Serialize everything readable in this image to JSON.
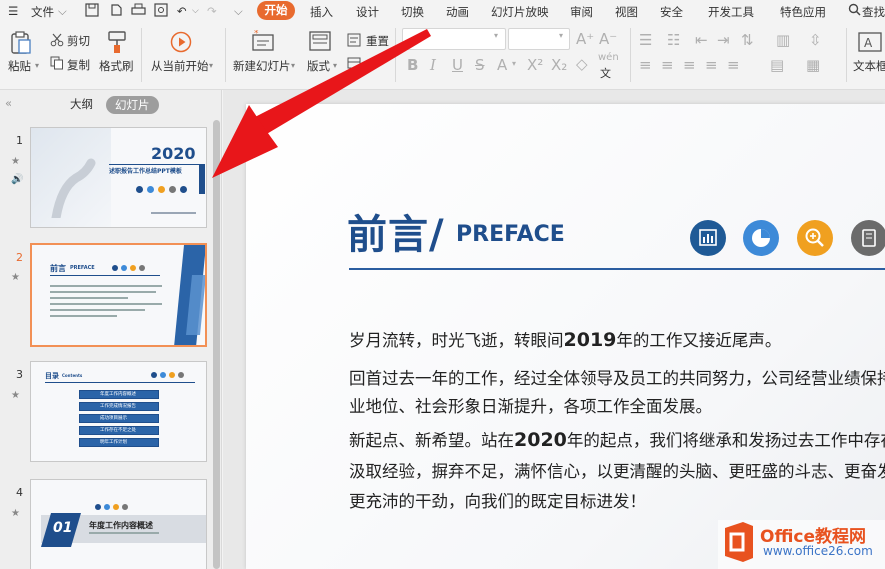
{
  "menubar": {
    "file": "文件",
    "tabs": [
      "开始",
      "插入",
      "设计",
      "切换",
      "动画",
      "幻灯片放映",
      "审阅",
      "视图",
      "安全",
      "开发工具",
      "特色应用"
    ],
    "search": "查找"
  },
  "ribbon": {
    "paste": "粘贴",
    "cut": "剪切",
    "copy": "复制",
    "format_painter": "格式刷",
    "from_current": "从当前开始",
    "new_slide": "新建幻灯片",
    "layout": "版式",
    "reset": "重置",
    "section": "节",
    "textbox": "文本框"
  },
  "left_panel": {
    "tab_outline": "大纲",
    "tab_slides": "幻灯片",
    "slides": [
      {
        "number": "1",
        "year": "2020",
        "title": "述职报告工作总结PPT模板"
      },
      {
        "number": "2",
        "title": "前言",
        "subtitle": "PREFACE"
      },
      {
        "number": "3",
        "title": "目录",
        "subtitle": "Contents",
        "items": [
          "年度工作内容概述",
          "工作完成情况报告",
          "成功项目展示",
          "工作存在不足之处",
          "明年工作计划"
        ]
      },
      {
        "number": "4",
        "title": "年度工作内容概述",
        "badge": "01"
      }
    ]
  },
  "slide": {
    "title_cn": "前言/",
    "title_en": "PREFACE",
    "p1_a": "岁月流转，时光飞逝，转眼间",
    "p1_year": "2019",
    "p1_b": "年的工作又接近尾声。",
    "p2": "回首过去一年的工作，经过全体领导及员工的共同努力，公司经营业绩保持",
    "p3": "业地位、社会形象日渐提升，各项工作全面发展。",
    "p4_a": "新起点、新希望。站在",
    "p4_year": "2020",
    "p4_b": "年的起点，我们将继承和发扬过去工作中存在",
    "p5": "汲取经验，摒弃不足，满怀信心，以更清醒的头脑、更旺盛的斗志、更奋发",
    "p6": "更充沛的干劲，向我们的既定目标进发！"
  },
  "watermark": {
    "brand": "Office教程网",
    "url": "www.office26.com"
  },
  "colors": {
    "accent_orange": "#e86a2e",
    "slide_blue": "#1f4e8c",
    "arrow_red": "#e8161a"
  }
}
